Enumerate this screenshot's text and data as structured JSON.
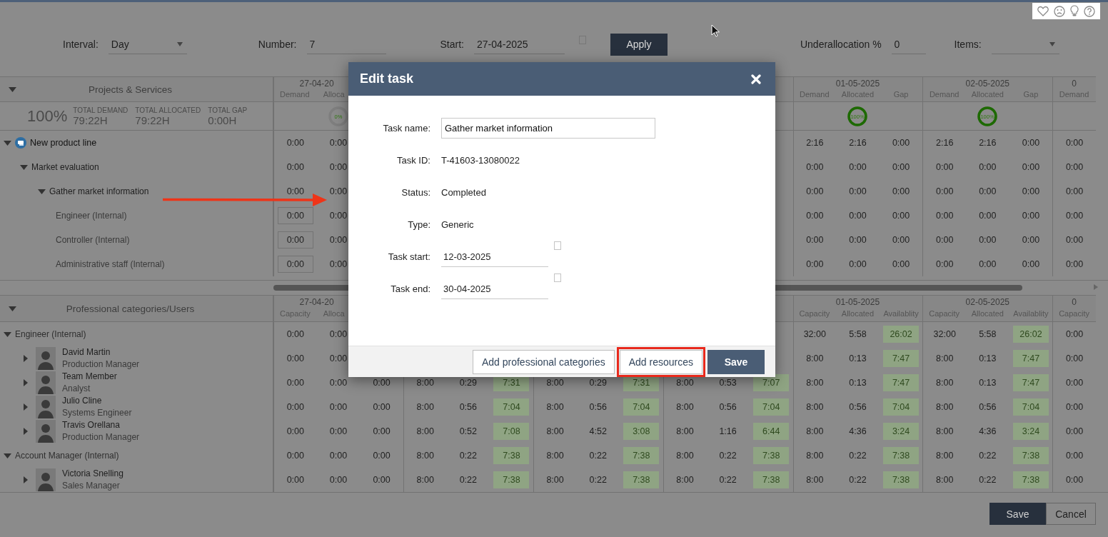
{
  "toolbar": {
    "interval": {
      "label": "Interval:",
      "value": "Day"
    },
    "number": {
      "label": "Number:",
      "value": "7"
    },
    "start": {
      "label": "Start:",
      "value": "27-04-2025"
    },
    "apply": "Apply",
    "underallocation": {
      "label": "Underallocation %",
      "value": "0"
    },
    "items": {
      "label": "Items:"
    }
  },
  "projects_grid": {
    "title": "Projects & Services",
    "percent": "100%",
    "totals": [
      {
        "label": "TOTAL DEMAND",
        "value": "79:22H"
      },
      {
        "label": "TOTAL ALLOCATED",
        "value": "79:22H"
      },
      {
        "label": "TOTAL GAP",
        "value": "0:00H"
      }
    ],
    "left_groups": [
      {
        "date": "27-04-20",
        "columns": [
          "Demand",
          "Alloca"
        ]
      }
    ],
    "right_groups": [
      {
        "date": "01-05-2025",
        "columns": [
          "Demand",
          "Allocated",
          "Gap"
        ]
      },
      {
        "date": "02-05-2025",
        "columns": [
          "Demand",
          "Allocated",
          "Gap"
        ]
      },
      {
        "date": "0",
        "columns": [
          "Demand"
        ]
      }
    ],
    "left_gauges": [
      {
        "label": "0%",
        "level": 0
      }
    ],
    "right_gauges": [
      {
        "label": "100%",
        "level": 1
      },
      {
        "label": "100%",
        "level": 1
      }
    ],
    "tree": [
      {
        "kind": "project",
        "label": "New product line",
        "expanded": true,
        "left_cells": [
          "0:00",
          "0:00"
        ],
        "right_cells": [
          "2:16",
          "2:16",
          "0:00",
          "2:16",
          "2:16",
          "0:00",
          "0:00"
        ],
        "children": [
          {
            "kind": "phase",
            "label": "Market evaluation",
            "expanded": true,
            "left_cells": [
              "0:00",
              "0:00"
            ],
            "right_cells": [
              "0:00",
              "0:00",
              "0:00",
              "0:00",
              "0:00",
              "0:00",
              "0:00"
            ],
            "children": [
              {
                "kind": "task",
                "label": "Gather market information",
                "expanded": true,
                "left_cells": [
                  "0:00",
                  "0:00"
                ],
                "right_cells": [
                  "0:00",
                  "0:00",
                  "0:00",
                  "0:00",
                  "0:00",
                  "0:00",
                  "0:00"
                ],
                "children": [
                  {
                    "kind": "resource",
                    "label": "Engineer (Internal)",
                    "left_cells": [
                      "0:00",
                      "0:00"
                    ],
                    "right_cells": [
                      "0:00",
                      "0:00",
                      "0:00",
                      "0:00",
                      "0:00",
                      "0:00",
                      "0:00"
                    ]
                  },
                  {
                    "kind": "resource",
                    "label": "Controller (Internal)",
                    "left_cells": [
                      "0:00",
                      "0:00"
                    ],
                    "right_cells": [
                      "0:00",
                      "0:00",
                      "0:00",
                      "0:00",
                      "0:00",
                      "0:00",
                      "0:00"
                    ]
                  },
                  {
                    "kind": "resource",
                    "label": "Administrative staff (Internal)",
                    "left_cells": [
                      "0:00",
                      "0:00"
                    ],
                    "right_cells": [
                      "0:00",
                      "0:00",
                      "0:00",
                      "0:00",
                      "0:00",
                      "0:00",
                      "0:00"
                    ]
                  }
                ]
              }
            ]
          }
        ]
      }
    ]
  },
  "users_grid": {
    "title": "Professional categories/Users",
    "shaded_groups": [
      false,
      true,
      true,
      true,
      true,
      true
    ],
    "left_groups": [
      {
        "date": "27-04-20",
        "columns": [
          "Capacity",
          "Alloca"
        ]
      }
    ],
    "right_groups": [
      {
        "date": "01-05-2025",
        "columns": [
          "Capacity",
          "Allocated",
          "Availablity"
        ]
      },
      {
        "date": "02-05-2025",
        "columns": [
          "Capacity",
          "Allocated",
          "Availablity"
        ]
      },
      {
        "date": "0",
        "columns": [
          "Capacity"
        ]
      }
    ],
    "tree": [
      {
        "kind": "category",
        "label": "Engineer (Internal)",
        "expanded": true,
        "left_cells": [
          "0:00",
          "0:00"
        ],
        "right_cells": [
          "32:00",
          "5:58",
          "26:02",
          "32:00",
          "5:58",
          "26:02",
          "0:00"
        ],
        "children": [
          {
            "kind": "person",
            "name": "David Martin",
            "role": "Production Manager",
            "expanded": false,
            "left_cells": [
              "0:00",
              "0:00"
            ],
            "right_cells": [
              "8:00",
              "0:13",
              "7:47",
              "8:00",
              "0:13",
              "7:47",
              "0:00"
            ]
          },
          {
            "kind": "person",
            "name": "Team Member",
            "role": "Analyst",
            "expanded": false,
            "cells": [
              "0:00",
              "0:00",
              "0:00",
              "8:00",
              "0:29",
              "7:31",
              "8:00",
              "0:29",
              "7:31",
              "8:00",
              "0:53",
              "7:07",
              "8:00",
              "0:13",
              "7:47",
              "8:00",
              "0:13",
              "7:47",
              "0:00"
            ]
          },
          {
            "kind": "person",
            "name": "Julio Cline",
            "role": "Systems Engineer",
            "expanded": false,
            "cells": [
              "0:00",
              "0:00",
              "0:00",
              "8:00",
              "0:56",
              "7:04",
              "8:00",
              "0:56",
              "7:04",
              "8:00",
              "0:56",
              "7:04",
              "8:00",
              "0:56",
              "7:04",
              "8:00",
              "0:56",
              "7:04",
              "0:00"
            ]
          },
          {
            "kind": "person",
            "name": "Travis Orellana",
            "role": "Production Manager",
            "expanded": false,
            "cells": [
              "0:00",
              "0:00",
              "0:00",
              "8:00",
              "0:52",
              "7:08",
              "8:00",
              "4:52",
              "3:08",
              "8:00",
              "1:16",
              "6:44",
              "8:00",
              "4:36",
              "3:24",
              "8:00",
              "4:36",
              "3:24",
              "0:00"
            ]
          }
        ]
      },
      {
        "kind": "category",
        "label": "Account Manager (Internal)",
        "expanded": true,
        "cells": [
          "0:00",
          "0:00",
          "0:00",
          "8:00",
          "0:22",
          "7:38",
          "8:00",
          "0:22",
          "7:38",
          "8:00",
          "0:22",
          "7:38",
          "8:00",
          "0:22",
          "7:38",
          "8:00",
          "0:22",
          "7:38",
          "0:00"
        ],
        "children": [
          {
            "kind": "person",
            "name": "Victoria Snelling",
            "role": "Sales Manager",
            "expanded": false,
            "cells": [
              "0:00",
              "0:00",
              "0:00",
              "8:00",
              "0:22",
              "7:38",
              "8:00",
              "0:22",
              "7:38",
              "8:00",
              "0:22",
              "7:38",
              "8:00",
              "0:22",
              "7:38",
              "8:00",
              "0:22",
              "7:38",
              "0:00"
            ]
          }
        ]
      }
    ]
  },
  "modal": {
    "title": "Edit task",
    "fields": [
      {
        "kind": "input",
        "label": "Task name:",
        "value": "Gather market information"
      },
      {
        "kind": "text",
        "label": "Task ID:",
        "value": "T-41603-13080022"
      },
      {
        "kind": "text",
        "label": "Status:",
        "value": "Completed"
      },
      {
        "kind": "text",
        "label": "Type:",
        "value": "Generic"
      },
      {
        "kind": "date",
        "label": "Task start:",
        "value": "12-03-2025"
      },
      {
        "kind": "date",
        "label": "Task end:",
        "value": "30-04-2025"
      }
    ],
    "buttons": [
      {
        "kind": "secondary",
        "label": "Add professional categories",
        "highlighted": false
      },
      {
        "kind": "secondary",
        "label": "Add resources",
        "highlighted": true
      },
      {
        "kind": "primary",
        "label": "Save",
        "highlighted": false
      }
    ]
  },
  "page_buttons": [
    {
      "kind": "primary",
      "label": "Save"
    },
    {
      "kind": "secondary",
      "label": "Cancel"
    }
  ]
}
